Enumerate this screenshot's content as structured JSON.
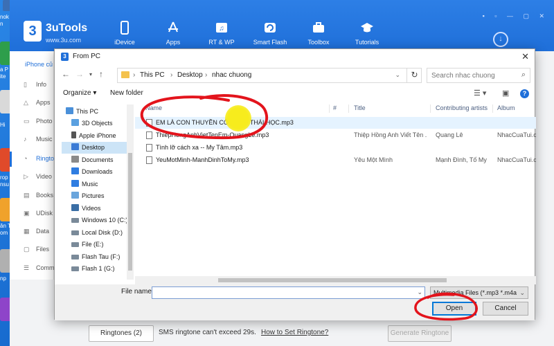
{
  "desktop": {
    "left_labels": [
      "nok",
      "n",
      "a P",
      "ite",
      "Hi",
      "rop",
      "nsu",
      "ăn T",
      "om",
      "np"
    ]
  },
  "app": {
    "brand": "3uTools",
    "site": "www.3u.com",
    "logo_char": "3",
    "nav": [
      {
        "label": "iDevice",
        "icon": "phone-icon"
      },
      {
        "label": "Apps",
        "icon": "app-store-icon"
      },
      {
        "label": "RT & WP",
        "icon": "music-icon"
      },
      {
        "label": "Smart Flash",
        "icon": "flash-icon"
      },
      {
        "label": "Toolbox",
        "icon": "toolbox-icon"
      },
      {
        "label": "Tutorials",
        "icon": "graduation-cap-icon"
      }
    ],
    "device_label": "iPhone củ",
    "sidebar": [
      {
        "label": "Info",
        "glyph": "▯"
      },
      {
        "label": "Apps",
        "glyph": "△"
      },
      {
        "label": "Photo",
        "glyph": "▭"
      },
      {
        "label": "Music",
        "glyph": "♪"
      },
      {
        "label": "Ringto",
        "glyph": "◔"
      },
      {
        "label": "Video",
        "glyph": "▷"
      },
      {
        "label": "Books",
        "glyph": "▤"
      },
      {
        "label": "UDisk",
        "glyph": "▣"
      },
      {
        "label": "Data",
        "glyph": "▦"
      },
      {
        "label": "Files",
        "glyph": "▢"
      },
      {
        "label": "Comm",
        "glyph": "☰"
      }
    ],
    "footer": {
      "ringtones_button": "Ringtones (2)",
      "notice": "SMS ringtone can't exceed 29s.",
      "how_link": "How to Set Ringtone?",
      "generate_button": "Generate Ringtone"
    }
  },
  "dialog": {
    "title": "From PC",
    "title_icon": "3",
    "breadcrumb": [
      "This PC",
      "Desktop",
      "nhac chuong"
    ],
    "search_placeholder": "Search nhac chuong",
    "organize": "Organize ▾",
    "new_folder": "New folder",
    "tree": [
      {
        "label": "This PC",
        "icon": "pc-icon",
        "color": "#4a90d9",
        "indent": 0
      },
      {
        "label": "3D Objects",
        "icon": "cube-icon",
        "color": "#5aa0e0",
        "indent": 1
      },
      {
        "label": "Apple iPhone",
        "icon": "phone-icon",
        "color": "#555555",
        "indent": 1
      },
      {
        "label": "Desktop",
        "icon": "desktop-icon",
        "color": "#3a7bd5",
        "indent": 1,
        "selected": true
      },
      {
        "label": "Documents",
        "icon": "document-icon",
        "color": "#8a8a8a",
        "indent": 1
      },
      {
        "label": "Downloads",
        "icon": "download-icon",
        "color": "#2f7de1",
        "indent": 1
      },
      {
        "label": "Music",
        "icon": "music-icon",
        "color": "#2f7de1",
        "indent": 1
      },
      {
        "label": "Pictures",
        "icon": "picture-icon",
        "color": "#6aa5dc",
        "indent": 1
      },
      {
        "label": "Videos",
        "icon": "video-icon",
        "color": "#3a6ea5",
        "indent": 1
      },
      {
        "label": "Windows 10 (C:)",
        "icon": "drive-icon",
        "color": "#7a8a99",
        "indent": 1
      },
      {
        "label": "Local Disk (D:)",
        "icon": "drive-icon",
        "color": "#7a8a99",
        "indent": 1
      },
      {
        "label": "File (E:)",
        "icon": "drive-icon",
        "color": "#7a8a99",
        "indent": 1
      },
      {
        "label": "Flash Tau (F:)",
        "icon": "drive-icon",
        "color": "#7a8a99",
        "indent": 1
      },
      {
        "label": "Flash 1 (G:)",
        "icon": "drive-icon",
        "color": "#7a8a99",
        "indent": 1
      }
    ],
    "columns": {
      "name": "Name",
      "number": "#",
      "title": "Title",
      "artists": "Contributing artists",
      "album": "Album"
    },
    "files": [
      {
        "name": "EM LÀ CON THUYỀN CÔ ĐƠN - THÁI HỌC.mp3",
        "title": "",
        "artists": "",
        "album": "",
        "hover": true
      },
      {
        "name": "ThiepHongAnhVietTenEm-QuangLe.mp3",
        "title": "Thiệp Hồng Anh Viết Tên ...",
        "artists": "Quang Lê",
        "album": "NhacCuaTui.co"
      },
      {
        "name": "Tình lỡ cách xa -- My Tâm.mp3",
        "title": "",
        "artists": "",
        "album": ""
      },
      {
        "name": "YeuMotMinh-ManhDinhToMy.mp3",
        "title": "Yêu Một Mình",
        "artists": "Mạnh Đình, Tố My",
        "album": "NhacCuaTui.co"
      }
    ],
    "file_name_label": "File name:",
    "file_name_value": "",
    "file_type": "Multimedia Files (*.mp3 *.m4a",
    "open_button": "Open",
    "cancel_button": "Cancel"
  },
  "colors": {
    "accent": "#1f6fd9",
    "annotation": "#e3141c",
    "cursor_highlight": "#f7ec1d"
  }
}
